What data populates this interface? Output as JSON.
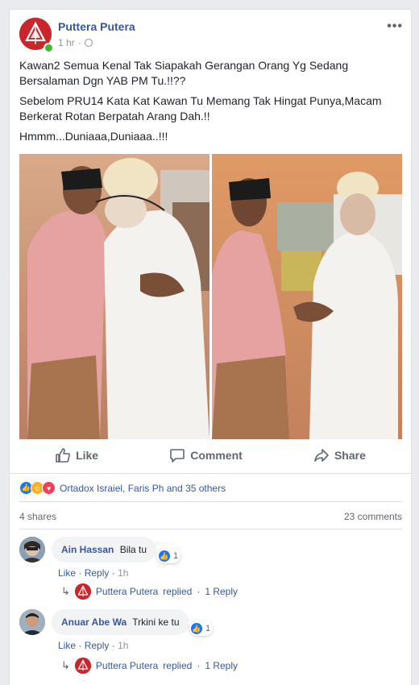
{
  "post": {
    "author": "Puttera Putera",
    "time": "1 hr",
    "more_label": "•••",
    "paragraphs": [
      "Kawan2 Semua Kenal Tak Siapakah Gerangan Orang Yg Sedang Bersalaman Dgn YAB PM Tu.!!??",
      "Sebelom PRU14 Kata Kat Kawan Tu Memang Tak Hingat Punya,Macam Berkerat Rotan Berpatah Arang Dah.!!",
      "Hmmm...Duniaaa,Duniaaa..!!!"
    ]
  },
  "actions": {
    "like": "Like",
    "comment": "Comment",
    "share": "Share"
  },
  "reactions": {
    "names": "Ortadox Israiel, Faris Ph and 35 others",
    "icons": [
      "like-icon",
      "haha-icon",
      "love-icon"
    ]
  },
  "stats": {
    "shares": "4 shares",
    "comments": "23 comments"
  },
  "comments": [
    {
      "name": "Ain Hassan",
      "text": "Bila tu",
      "likes": "1",
      "like_label": "Like",
      "reply_label": "Reply",
      "time": "1h",
      "reply_author": "Puttera Putera",
      "reply_verb": "replied",
      "reply_count": "1 Reply"
    },
    {
      "name": "Anuar Abe Wa",
      "text": "Trkini ke tu",
      "likes": "1",
      "like_label": "Like",
      "reply_label": "Reply",
      "time": "1h",
      "reply_author": "Puttera Putera",
      "reply_verb": "replied",
      "reply_count": "1 Reply"
    }
  ],
  "colors": {
    "link": "#365899",
    "brand_red": "#c8262b",
    "online": "#42b72a",
    "muted": "#606770"
  }
}
